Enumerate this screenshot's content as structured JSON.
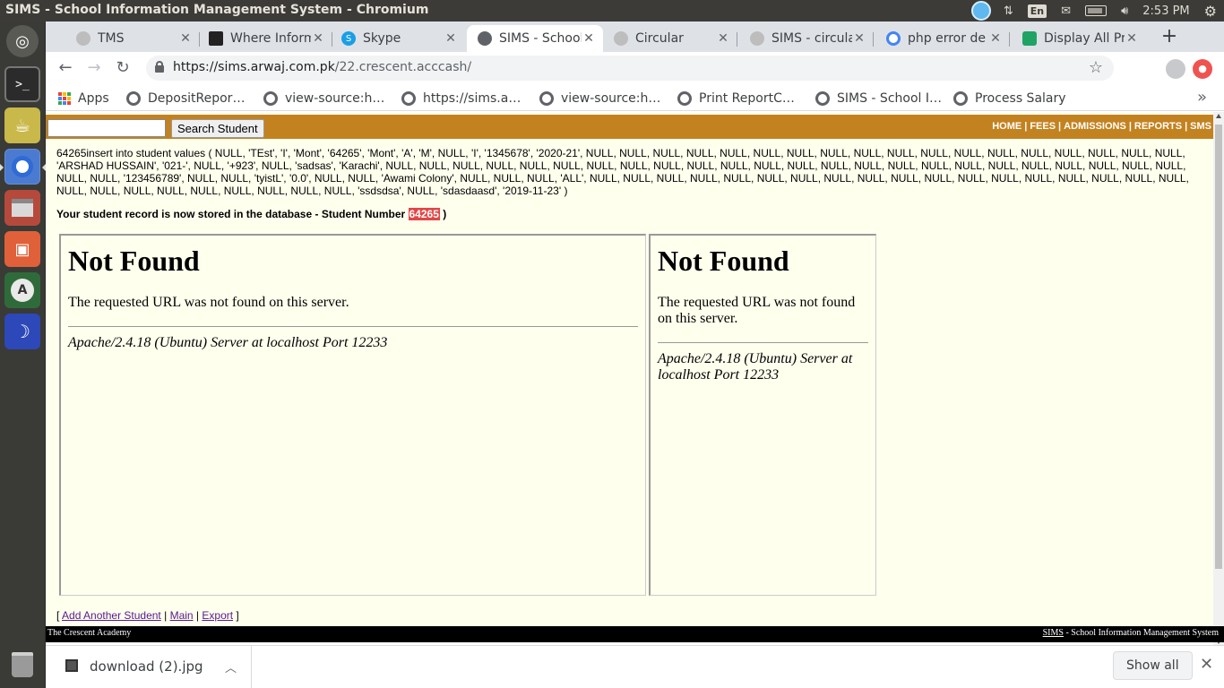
{
  "os": {
    "window_title": "SIMS - School Information Management System - Chromium",
    "clock": "2:53 PM",
    "keyboard_layout": "En",
    "launcher_apps": [
      "dash-icon",
      "terminal-icon",
      "teapot-icon",
      "chromium-icon",
      "files-icon",
      "image-viewer-icon",
      "software-updater-icon",
      "blue-app-icon",
      "trash-icon"
    ]
  },
  "browser": {
    "tabs": [
      {
        "title": "TMS",
        "icon": "globe-icon",
        "active": false
      },
      {
        "title": "Where Inform",
        "icon": "site-dark-icon",
        "active": false
      },
      {
        "title": "Skype",
        "icon": "skype-icon",
        "active": false
      },
      {
        "title": "SIMS - School",
        "icon": "globe-icon",
        "active": true
      },
      {
        "title": "Circular",
        "icon": "globe-icon",
        "active": false
      },
      {
        "title": "SIMS - circula",
        "icon": "globe-icon",
        "active": false
      },
      {
        "title": "php error de",
        "icon": "google-icon",
        "active": false
      },
      {
        "title": "Display All Pr",
        "icon": "green-leaf-icon",
        "active": false
      }
    ],
    "url_main": "https://sims.arwaj.com.pk",
    "url_path": "/22.crescent.acccash/",
    "bookmarks": [
      "Apps",
      "DepositRepor…",
      "view-source:h…",
      "https://sims.a…",
      "view-source:h…",
      "Print ReportC…",
      "SIMS - School I…",
      "Process Salary"
    ]
  },
  "page": {
    "search_button": "Search Student",
    "search_value": "",
    "nav": [
      "HOME",
      "FEES",
      "ADMISSIONS",
      "REPORTS",
      "SMS"
    ],
    "sql_text": "64265insert into student values ( NULL, 'TEst', 'I', 'Mont', '64265', 'Mont', 'A', 'M', NULL, 'I', '1345678', '2020-21', NULL, NULL, NULL, NULL, NULL, NULL, NULL, NULL, NULL, NULL, NULL, NULL, NULL, NULL, NULL, NULL, NULL, NULL, 'ARSHAD HUSSAIN', '021-', NULL, '+923', NULL, 'sadsas', 'Karachi', NULL, NULL, NULL, NULL, NULL, NULL, NULL, NULL, NULL, NULL, NULL, NULL, NULL, NULL, NULL, NULL, NULL, NULL, NULL, NULL, NULL, NULL, NULL, NULL, NULL, NULL, '123456789', NULL, NULL, 'tyistL', '0.0', NULL, NULL, 'Awami Colony', NULL, NULL, NULL, 'ALL', NULL, NULL, NULL, NULL, NULL, NULL, NULL, NULL, NULL, NULL, NULL, NULL, NULL, NULL, NULL, NULL, NULL, NULL, NULL, NULL, NULL, NULL, NULL, NULL, NULL, NULL, NULL, 'ssdsdsa', NULL, 'sdasdaasd', '2019-11-23' )",
    "stored_prefix": "Your student record is now stored in the database - Student Number ",
    "student_number": "64265",
    "stored_suffix": " )",
    "frames": [
      {
        "heading": "Not Found",
        "message": "The requested URL was not found on this server.",
        "signature": "Apache/2.4.18 (Ubuntu) Server at localhost Port 12233"
      },
      {
        "heading": "Not Found",
        "message": "The requested URL was not found on this server.",
        "signature": "Apache/2.4.18 (Ubuntu) Server at localhost Port 12233"
      }
    ],
    "links": {
      "add": "Add Another Student",
      "main": "Main",
      "export": "Export"
    },
    "footer_left": "The Crescent Academy",
    "footer_right_abbr": "SIMS",
    "footer_right_rest": " - School Information Management System"
  },
  "downloads": {
    "file": "download (2).jpg",
    "show_all": "Show all"
  }
}
